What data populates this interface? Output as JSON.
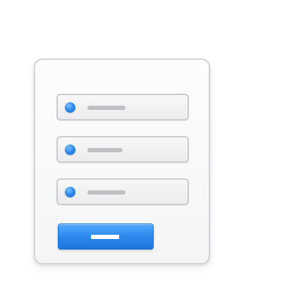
{
  "icon": {
    "name": "registration-form-icon",
    "colors": {
      "card_border": "#d2d4d7",
      "card_fill": "#f4f5f6",
      "field_border": "#c9cbce",
      "field_fill": "#ececee",
      "bullet": "#2f8df0",
      "placeholder": "#bdbfc2",
      "button": "#2f8cef",
      "button_label": "#ffffff"
    },
    "fields": [
      {
        "bullet_icon": "blue-dot-icon",
        "placeholder_icon": "text-line-icon"
      },
      {
        "bullet_icon": "blue-dot-icon",
        "placeholder_icon": "text-line-icon"
      },
      {
        "bullet_icon": "blue-dot-icon",
        "placeholder_icon": "text-line-icon"
      }
    ],
    "submit": {
      "label_icon": "text-line-icon"
    }
  }
}
